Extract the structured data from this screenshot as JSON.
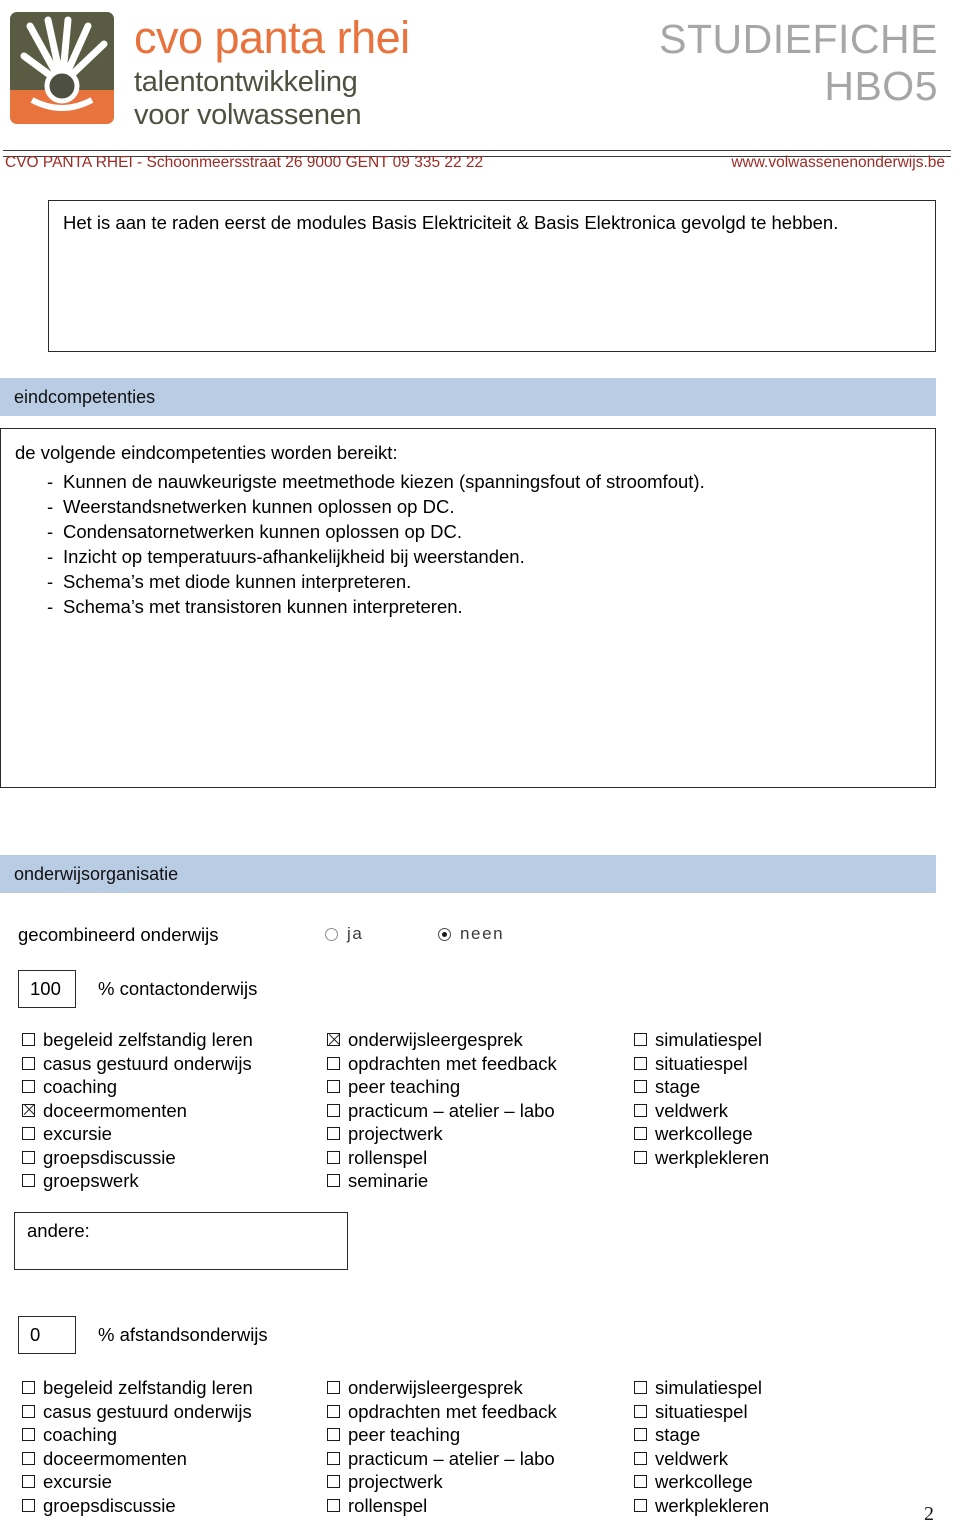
{
  "header": {
    "logo": {
      "brand_line": "cvo panta rhei",
      "tagline_1": "talentontwikkeling",
      "tagline_2": "voor volwassenen",
      "mark_top_color": "#595b43",
      "mark_bottom_color": "#e8733d",
      "brand_color": "#e8733d",
      "tagline_color": "#4f5140"
    },
    "doc_title_line1": "STUDIEFICHE",
    "doc_title_line2": "HBO5",
    "doc_title_color": "#a6a6a6"
  },
  "address_bar": {
    "left": "CVO PANTA RHEI  - Schoonmeersstraat 26   9000   GENT   09 335 22 22",
    "right": "www.volwassenenonderwijs.be",
    "color": "#9e2b25"
  },
  "note": {
    "text": "Het is aan te raden eerst de modules Basis Elektriciteit & Basis Elektronica gevolgd te hebben."
  },
  "eindcompetenties": {
    "section_title": "eindcompetenties",
    "section_bar_color": "#b8cce4",
    "intro": "de volgende eindcompetenties worden bereikt:",
    "bullet_marker": "-",
    "items": [
      "Kunnen de nauwkeurigste meetmethode kiezen (spanningsfout of stroomfout).",
      "Weerstandsnetwerken kunnen oplossen op DC.",
      "Condensatornetwerken kunnen oplossen op DC.",
      "Inzicht op temperatuurs-afhankelijkheid bij weerstanden.",
      "Schema’s met diode kunnen interpreteren.",
      "Schema’s met transistoren kunnen interpreteren."
    ]
  },
  "onderwijsorganisatie": {
    "section_title": "onderwijsorganisatie",
    "gecombineerd": {
      "label": "gecombineerd onderwijs",
      "option_ja": "ja",
      "option_neen": "neen",
      "selected": "neen"
    },
    "contactonderwijs": {
      "percent": "100",
      "label": "% contactonderwijs",
      "columns": [
        [
          {
            "label": "begeleid zelfstandig leren",
            "checked": false
          },
          {
            "label": "casus gestuurd onderwijs",
            "checked": false
          },
          {
            "label": "coaching",
            "checked": false
          },
          {
            "label": "doceermomenten",
            "checked": true
          },
          {
            "label": "excursie",
            "checked": false
          },
          {
            "label": "groepsdiscussie",
            "checked": false
          },
          {
            "label": "groepswerk",
            "checked": false
          }
        ],
        [
          {
            "label": "onderwijsleergesprek",
            "checked": true
          },
          {
            "label": "opdrachten met feedback",
            "checked": false
          },
          {
            "label": "peer teaching",
            "checked": false
          },
          {
            "label": "practicum – atelier – labo",
            "checked": false
          },
          {
            "label": "projectwerk",
            "checked": false
          },
          {
            "label": "rollenspel",
            "checked": false
          },
          {
            "label": "seminarie",
            "checked": false
          }
        ],
        [
          {
            "label": "simulatiespel",
            "checked": false
          },
          {
            "label": "situatiespel",
            "checked": false
          },
          {
            "label": "stage",
            "checked": false
          },
          {
            "label": "veldwerk",
            "checked": false
          },
          {
            "label": "werkcollege",
            "checked": false
          },
          {
            "label": "werkplekleren",
            "checked": false
          }
        ]
      ]
    },
    "andere": {
      "label": "andere:",
      "value": ""
    },
    "afstandsonderwijs": {
      "percent": "0",
      "label": "% afstandsonderwijs",
      "columns": [
        [
          {
            "label": "begeleid zelfstandig leren",
            "checked": false
          },
          {
            "label": "casus gestuurd onderwijs",
            "checked": false
          },
          {
            "label": "coaching",
            "checked": false
          },
          {
            "label": "doceermomenten",
            "checked": false
          },
          {
            "label": "excursie",
            "checked": false
          },
          {
            "label": "groepsdiscussie",
            "checked": false
          }
        ],
        [
          {
            "label": "onderwijsleergesprek",
            "checked": false
          },
          {
            "label": "opdrachten met feedback",
            "checked": false
          },
          {
            "label": "peer teaching",
            "checked": false
          },
          {
            "label": "practicum – atelier – labo",
            "checked": false
          },
          {
            "label": "projectwerk",
            "checked": false
          },
          {
            "label": "rollenspel",
            "checked": false
          }
        ],
        [
          {
            "label": "simulatiespel",
            "checked": false
          },
          {
            "label": "situatiespel",
            "checked": false
          },
          {
            "label": "stage",
            "checked": false
          },
          {
            "label": "veldwerk",
            "checked": false
          },
          {
            "label": "werkcollege",
            "checked": false
          },
          {
            "label": "werkplekleren",
            "checked": false
          }
        ]
      ]
    }
  },
  "footer": {
    "page_number": "2"
  }
}
